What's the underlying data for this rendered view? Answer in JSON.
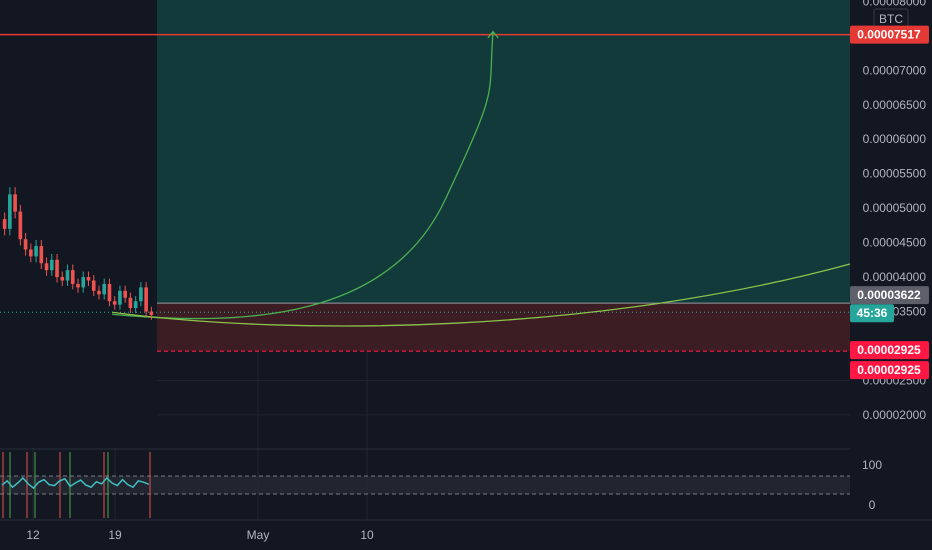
{
  "currency_label": "BTC",
  "colors": {
    "background": "#131722",
    "grid": "#1f2430",
    "profit_zone": "#133a3b",
    "loss_zone": "#3d1d24",
    "target_line": "#e53935",
    "stop_line": "#ff1744",
    "projection_steep": "#4caf50",
    "projection_gentle": "#8bc34a",
    "candle_up": "#26a69a",
    "candle_down": "#ef5350",
    "oscillator": "#3fbfbf"
  },
  "chart_data": {
    "type": "candlestick",
    "y_axis": {
      "ticks": [
        "0.00002000",
        "0.00002500",
        "0.00003000",
        "0.00003500",
        "0.00004000",
        "0.00004500",
        "0.00005000",
        "0.00005500",
        "0.00006000",
        "0.00006500",
        "0.00007000",
        "0.00007500",
        "0.00008000"
      ],
      "range": [
        1.52e-05,
        8.02e-05
      ]
    },
    "x_axis": {
      "ticks": [
        "12",
        "19",
        "May",
        "10"
      ]
    },
    "levels": {
      "target": {
        "value": 7.517e-05,
        "label": "0.00007517"
      },
      "entry": {
        "value": 3.622e-05,
        "label": "0.00003622"
      },
      "current": {
        "value": 3.49e-05,
        "countdown": "45:36"
      },
      "stop": [
        {
          "value": 2.925e-05,
          "label": "0.00002925"
        },
        {
          "value": 2.925e-05,
          "label": "0.00002925"
        }
      ]
    },
    "price_series": [
      4.7e-05,
      5.2e-05,
      4.95e-05,
      4.55e-05,
      4.4e-05,
      4.3e-05,
      4.45e-05,
      4.2e-05,
      4.1e-05,
      4.25e-05,
      4e-05,
      3.95e-05,
      4.1e-05,
      3.9e-05,
      3.85e-05,
      4e-05,
      3.95e-05,
      3.8e-05,
      3.75e-05,
      3.9e-05,
      3.65e-05,
      3.6e-05,
      3.8e-05,
      3.7e-05,
      3.55e-05,
      3.65e-05,
      3.85e-05,
      3.5e-05,
      3.45e-05
    ],
    "oscillator": {
      "ticks": [
        "100",
        "0"
      ],
      "upper_band": 70,
      "lower_band": 30,
      "values": [
        45,
        55,
        40,
        50,
        62,
        48,
        38,
        52,
        58,
        46,
        44,
        55,
        60,
        42,
        50,
        57,
        45,
        40,
        53,
        48,
        62,
        50,
        44,
        58,
        46,
        40,
        55,
        52,
        47
      ]
    }
  }
}
